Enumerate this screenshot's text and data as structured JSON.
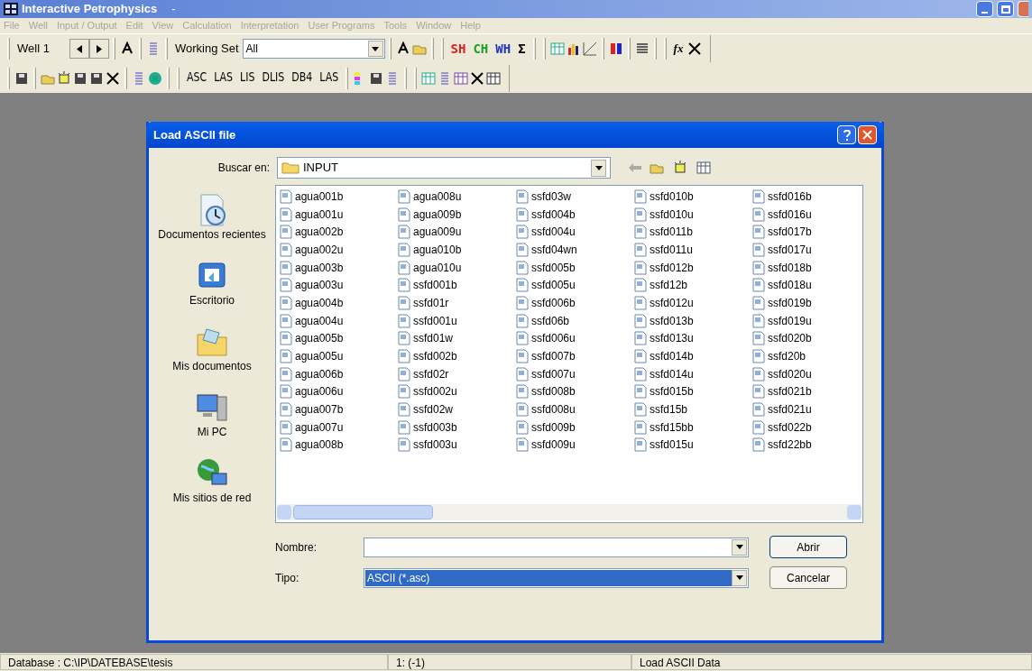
{
  "window": {
    "title": "Interactive Petrophysics",
    "title_suffix": "-"
  },
  "menu": [
    {
      "label": "File",
      "disabled": true
    },
    {
      "label": "Well",
      "disabled": true
    },
    {
      "label": "Input / Output",
      "disabled": true
    },
    {
      "label": "Edit",
      "disabled": true
    },
    {
      "label": "View",
      "disabled": true
    },
    {
      "label": "Calculation",
      "disabled": true
    },
    {
      "label": "Interpretation",
      "disabled": true
    },
    {
      "label": "User Programs",
      "disabled": true
    },
    {
      "label": "Tools",
      "disabled": true
    },
    {
      "label": "Window",
      "disabled": true
    },
    {
      "label": "Help",
      "disabled": true
    }
  ],
  "toolbar": {
    "well": "Well 1",
    "working_set_label": "Working Set",
    "working_set_value": "All",
    "hole_buttons": [
      {
        "label": "SH",
        "color": "#e02020"
      },
      {
        "label": "CH",
        "color": "#20a020"
      },
      {
        "label": "WH",
        "color": "#2030c0"
      },
      {
        "label": "Σ",
        "color": "#000000"
      }
    ],
    "function_label": "fx",
    "format_buttons": [
      "ASC",
      "LAS",
      "LIS",
      "DLIS",
      "DB4",
      "LAS"
    ]
  },
  "dialog": {
    "title": "Load ASCII file",
    "look_in_label": "Buscar en:",
    "look_in_value": "INPUT",
    "places": [
      "Documentos recientes",
      "Escritorio",
      "Mis documentos",
      "Mi PC",
      "Mis sitios de red"
    ],
    "files": [
      "agua001b",
      "agua001u",
      "agua002b",
      "agua002u",
      "agua003b",
      "agua003u",
      "agua004b",
      "agua004u",
      "agua005b",
      "agua005u",
      "agua006b",
      "agua006u",
      "agua007b",
      "agua007u",
      "agua008b",
      "agua008u",
      "agua009b",
      "agua009u",
      "agua010b",
      "agua010u",
      "ssfd001b",
      "ssfd01r",
      "ssfd001u",
      "ssfd01w",
      "ssfd002b",
      "ssfd02r",
      "ssfd002u",
      "ssfd02w",
      "ssfd003b",
      "ssfd003u",
      "ssfd03w",
      "ssfd004b",
      "ssfd004u",
      "ssfd04wn",
      "ssfd005b",
      "ssfd005u",
      "ssfd006b",
      "ssfd06b",
      "ssfd006u",
      "ssfd007b",
      "ssfd007u",
      "ssfd008b",
      "ssfd008u",
      "ssfd009b",
      "ssfd009u",
      "ssfd010b",
      "ssfd010u",
      "ssfd011b",
      "ssfd011u",
      "ssfd012b",
      "ssfd12b",
      "ssfd012u",
      "ssfd013b",
      "ssfd013u",
      "ssfd014b",
      "ssfd014u",
      "ssfd015b",
      "ssfd15b",
      "ssfd15bb",
      "ssfd015u",
      "ssfd016b",
      "ssfd016u",
      "ssfd017b",
      "ssfd017u",
      "ssfd018b",
      "ssfd018u",
      "ssfd019b",
      "ssfd019u",
      "ssfd020b",
      "ssfd20b",
      "ssfd020u",
      "ssfd021b",
      "ssfd021u",
      "ssfd022b",
      "ssfd22bb"
    ],
    "name_label": "Nombre:",
    "type_label": "Tipo:",
    "type_value": "ASCII (*.asc)",
    "buttons": [
      "Abrir",
      "Cancelar"
    ]
  },
  "status_bar": [
    "Database : C:\\IP\\DATEBASE\\tesis",
    "1: (-1)",
    "Load ASCII Data"
  ]
}
